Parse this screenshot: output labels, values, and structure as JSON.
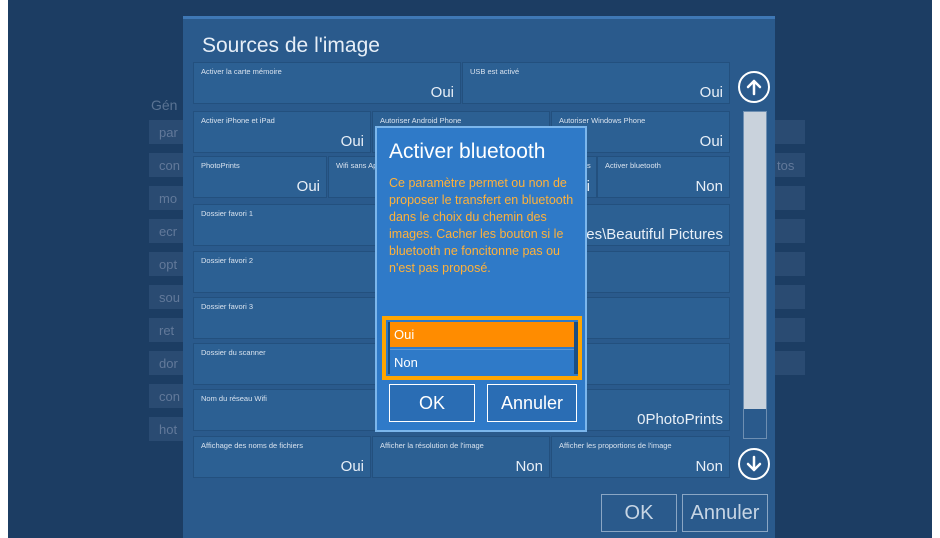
{
  "background": {
    "section_title": "Gén",
    "items": [
      "par",
      "con",
      "mo",
      "ecr",
      "opt",
      "sou",
      "ret",
      "dor",
      "con",
      "hot"
    ],
    "right_items": [
      "",
      "tos",
      "",
      "",
      "",
      "",
      "",
      ""
    ]
  },
  "dialog": {
    "title": "Sources de l'image",
    "fields": [
      {
        "label": "Activer la carte mémoire",
        "value": "Oui"
      },
      {
        "label": "USB est activé",
        "value": "Oui"
      },
      {
        "label": "Activer iPhone et iPad",
        "value": "Oui"
      },
      {
        "label": "Autoriser Android Phone",
        "value": ""
      },
      {
        "label": "Autoriser Windows Phone",
        "value": "Oui"
      },
      {
        "label": "PhotoPrints",
        "value": "Oui"
      },
      {
        "label": "Wifi sans App",
        "value": ""
      },
      {
        "label": "s",
        "value": "i"
      },
      {
        "label": "Activer bluetooth",
        "value": "Non"
      },
      {
        "label": "Dossier favori 1",
        "value": "res\\Beautiful Pictures"
      },
      {
        "label": "Dossier favori 2",
        "value": ""
      },
      {
        "label": "Dossier favori 3",
        "value": ""
      },
      {
        "label": "Dossier du scanner",
        "value": ""
      },
      {
        "label": "Nom du réseau Wifi",
        "value": "0PhotoPrints"
      },
      {
        "label": "Affichage des noms de fichiers",
        "value": "Oui"
      },
      {
        "label": "Afficher la résolution de l'image",
        "value": "Non"
      },
      {
        "label": "Afficher les proportions de l'image",
        "value": "Non"
      }
    ],
    "ok_label": "OK",
    "cancel_label": "Annuler"
  },
  "popup": {
    "title": "Activer bluetooth",
    "description": "Ce paramètre permet ou non de proposer le transfert en bluetooth dans le choix du chemin des images. Cacher les bouton si le bluetooth ne foncitonne pas ou n'est pas proposé.",
    "options": [
      "Oui",
      "Non"
    ],
    "selected_option": "Oui",
    "ok_label": "OK",
    "cancel_label": "Annuler"
  },
  "icons": {
    "scroll_up": "arrow-up-circle-icon",
    "scroll_down": "arrow-down-circle-icon"
  },
  "colors": {
    "accent": "#ff8c00",
    "highlight_border": "#ffa500",
    "popup_bg": "#2f7ac8",
    "dialog_bg": "#2a5a8c",
    "description_text": "#ffb13a"
  }
}
